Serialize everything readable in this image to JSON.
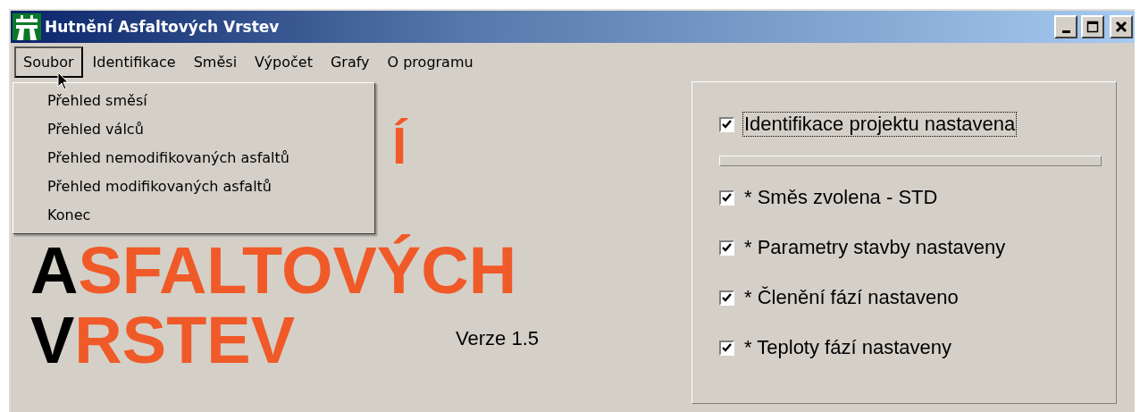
{
  "window": {
    "title": "Hutnění Asfaltových Vrstev"
  },
  "menu_bar": [
    {
      "label": "Soubor",
      "selected": true
    },
    {
      "label": "Identifikace",
      "selected": false
    },
    {
      "label": "Směsi",
      "selected": false
    },
    {
      "label": "Výpočet",
      "selected": false
    },
    {
      "label": "Grafy",
      "selected": false
    },
    {
      "label": "O programu",
      "selected": false
    }
  ],
  "dropdown": {
    "items": [
      "Přehled směsí",
      "Přehled válců",
      "Přehled nemodifikovaných asfaltů",
      "Přehled modifikovaných asfaltů",
      "Konec"
    ]
  },
  "title_lines": [
    {
      "rest": "Í"
    },
    {
      "lead": "A",
      "rest": "SFALTOVÝCH"
    },
    {
      "lead": "V",
      "rest": "RSTEV"
    }
  ],
  "version": "Verze 1.5",
  "status_checks": [
    {
      "label": "Identifikace projektu nastavena",
      "checked": true,
      "focused": true
    },
    {
      "label": "* Směs zvolena - STD",
      "checked": true,
      "focused": false
    },
    {
      "label": "* Parametry stavby nastaveny",
      "checked": true,
      "focused": false
    },
    {
      "label": "* Členění fází nastaveno",
      "checked": true,
      "focused": false
    },
    {
      "label": "* Teploty fází nastaveny",
      "checked": true,
      "focused": false
    }
  ]
}
